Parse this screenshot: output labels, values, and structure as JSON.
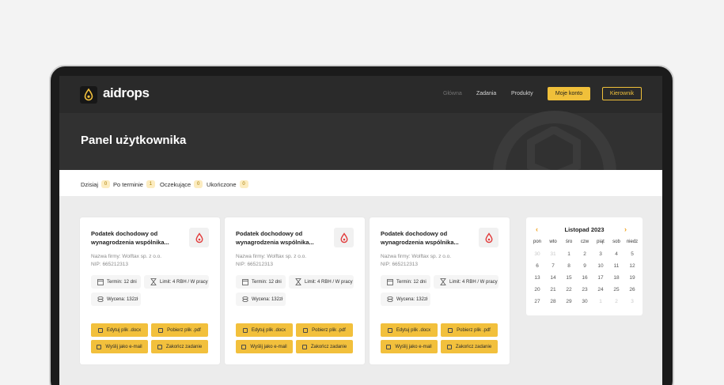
{
  "header": {
    "logo_text": "aidrops",
    "nav": [
      "Główna",
      "Zadania",
      "Produkty"
    ],
    "account_button": "Moje konto",
    "manager_button": "Kierownik"
  },
  "page_title": "Panel użytkownika",
  "filters": [
    {
      "label": "Dzisiaj",
      "count": "0"
    },
    {
      "label": "Po terminie",
      "count": "1"
    },
    {
      "label": "Oczekujące",
      "count": "0"
    },
    {
      "label": "Ukończone",
      "count": "0"
    }
  ],
  "cards": [
    {
      "title": "Podatek dochodowy od wynagrodzenia wspólnika...",
      "company": "Nazwa firmy: Wolftax sp. z o.o.",
      "nip": "NIP: 665212313",
      "deadline": "Termin: 12 dni",
      "limit": "Limit: 4 RBH / W pracy",
      "valuation": "Wycena: 132zł",
      "actions": [
        "Edytuj plik .docx",
        "Pobierz plik .pdf",
        "Wyślij jako e-mail",
        "Zakończ zadanie"
      ]
    },
    {
      "title": "Podatek dochodowy od wynagrodzenia wspólnika...",
      "company": "Nazwa firmy: Wolftax sp. z o.o.",
      "nip": "NIP: 665212313",
      "deadline": "Termin: 12 dni",
      "limit": "Limit: 4 RBH / W pracy",
      "valuation": "Wycena: 132zł",
      "actions": [
        "Edytuj plik .docx",
        "Pobierz plik .pdf",
        "Wyślij jako e-mail",
        "Zakończ zadanie"
      ]
    },
    {
      "title": "Podatek dochodowy od wynagrodzenia wspólnika...",
      "company": "Nazwa firmy: Wolftax sp. z o.o.",
      "nip": "NIP: 665212313",
      "deadline": "Termin: 12 dni",
      "limit": "Limit: 4 RBH / W pracy",
      "valuation": "Wycena: 132zł",
      "actions": [
        "Edytuj plik .docx",
        "Pobierz plik .pdf",
        "Wyślij jako e-mail",
        "Zakończ zadanie"
      ]
    }
  ],
  "calendar": {
    "month": "Listopad 2023",
    "prev_glyph": "‹",
    "next_glyph": "›",
    "weekdays": [
      "pon",
      "wto",
      "śro",
      "czw",
      "piąt",
      "sob",
      "niedz"
    ],
    "days": [
      {
        "d": "30",
        "muted": true
      },
      {
        "d": "31",
        "muted": true
      },
      {
        "d": "1"
      },
      {
        "d": "2"
      },
      {
        "d": "3"
      },
      {
        "d": "4"
      },
      {
        "d": "5"
      },
      {
        "d": "6"
      },
      {
        "d": "7"
      },
      {
        "d": "8"
      },
      {
        "d": "9"
      },
      {
        "d": "10"
      },
      {
        "d": "11"
      },
      {
        "d": "12"
      },
      {
        "d": "13"
      },
      {
        "d": "14"
      },
      {
        "d": "15"
      },
      {
        "d": "16"
      },
      {
        "d": "17"
      },
      {
        "d": "18"
      },
      {
        "d": "19"
      },
      {
        "d": "20"
      },
      {
        "d": "21"
      },
      {
        "d": "22"
      },
      {
        "d": "23"
      },
      {
        "d": "24"
      },
      {
        "d": "25"
      },
      {
        "d": "26"
      },
      {
        "d": "27"
      },
      {
        "d": "28"
      },
      {
        "d": "29"
      },
      {
        "d": "30"
      },
      {
        "d": "1",
        "muted": true
      },
      {
        "d": "2",
        "muted": true
      },
      {
        "d": "3",
        "muted": true
      }
    ]
  },
  "colors": {
    "accent": "#f2c03c",
    "dark": "#2a2a2a",
    "calendar_arrow": "#f0a21d",
    "drop_icon": "#e23b3b"
  },
  "icons": {
    "logo": "drop-icon",
    "card": "drop-icon",
    "deadline": "calendar-icon",
    "limit": "hourglass-icon",
    "valuation": "coins-icon",
    "edit": "edit-icon",
    "download": "download-icon",
    "mail": "mail-icon",
    "finish": "check-icon"
  }
}
